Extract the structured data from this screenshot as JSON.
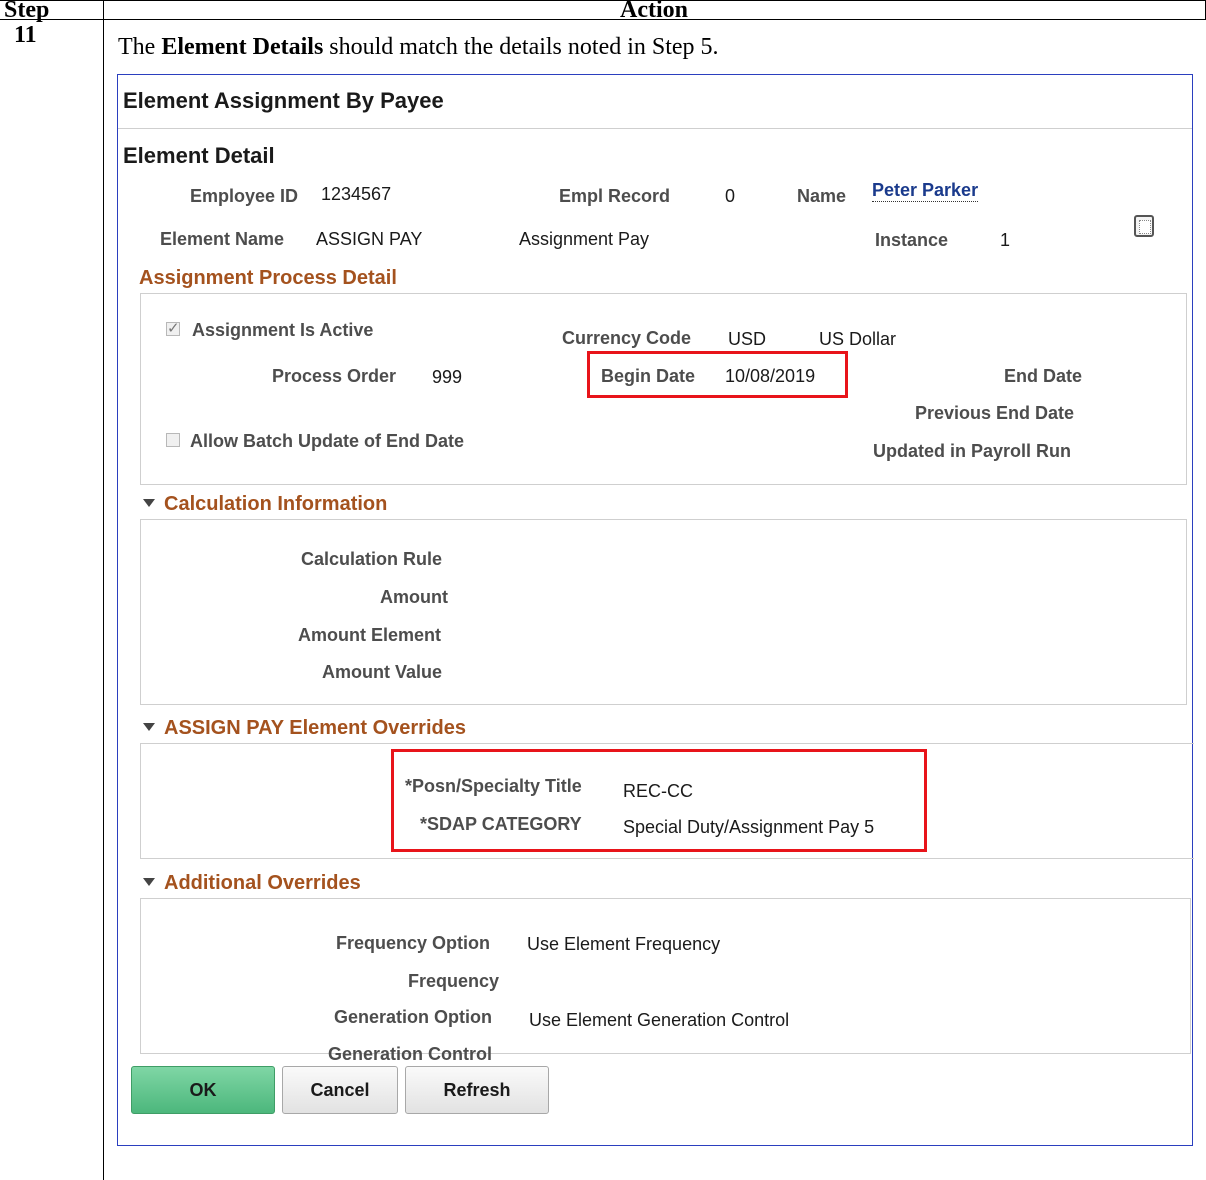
{
  "doc": {
    "col_step": "Step",
    "col_action": "Action",
    "step_number": "11",
    "intro_prefix": "The ",
    "intro_bold": "Element Details",
    "intro_suffix": " should match the details noted in Step 5."
  },
  "page": {
    "title": "Element Assignment By Payee",
    "subtitle": "Element Detail"
  },
  "header": {
    "employee_id_label": "Employee ID",
    "employee_id": "1234567",
    "empl_record_label": "Empl Record",
    "empl_record": "0",
    "name_label": "Name",
    "name": "Peter Parker",
    "element_name_label": "Element Name",
    "element_name": "ASSIGN PAY",
    "element_desc": "Assignment Pay",
    "instance_label": "Instance",
    "instance": "1"
  },
  "process": {
    "title": "Assignment Process Detail",
    "active_label": "Assignment Is Active",
    "active_checked": true,
    "currency_label": "Currency Code",
    "currency_code": "USD",
    "currency_name": "US Dollar",
    "process_order_label": "Process Order",
    "process_order": "999",
    "begin_date_label": "Begin Date",
    "begin_date": "10/08/2019",
    "end_date_label": "End Date",
    "prev_end_date_label": "Previous End Date",
    "batch_label": "Allow Batch Update of End Date",
    "batch_checked": false,
    "updated_label": "Updated in Payroll Run"
  },
  "calc": {
    "title": "Calculation Information",
    "rule_label": "Calculation Rule",
    "amount_label": "Amount",
    "amount_element_label": "Amount Element",
    "amount_value_label": "Amount Value"
  },
  "overrides": {
    "title": "ASSIGN PAY Element Overrides",
    "posn_label": "*Posn/Specialty Title",
    "posn_value": "REC-CC",
    "sdap_label": "*SDAP CATEGORY",
    "sdap_value": "Special Duty/Assignment Pay 5"
  },
  "additional": {
    "title": "Additional Overrides",
    "freq_option_label": "Frequency Option",
    "freq_option": "Use Element Frequency",
    "frequency_label": "Frequency",
    "gen_option_label": "Generation Option",
    "gen_option": "Use Element Generation Control",
    "gen_control_label": "Generation Control"
  },
  "buttons": {
    "ok": "OK",
    "cancel": "Cancel",
    "refresh": "Refresh"
  },
  "colors": {
    "highlight": "#e8141a",
    "section_title": "#a4521e",
    "ok_button": "#4cb77c",
    "panel_border": "#2b3fbf"
  }
}
